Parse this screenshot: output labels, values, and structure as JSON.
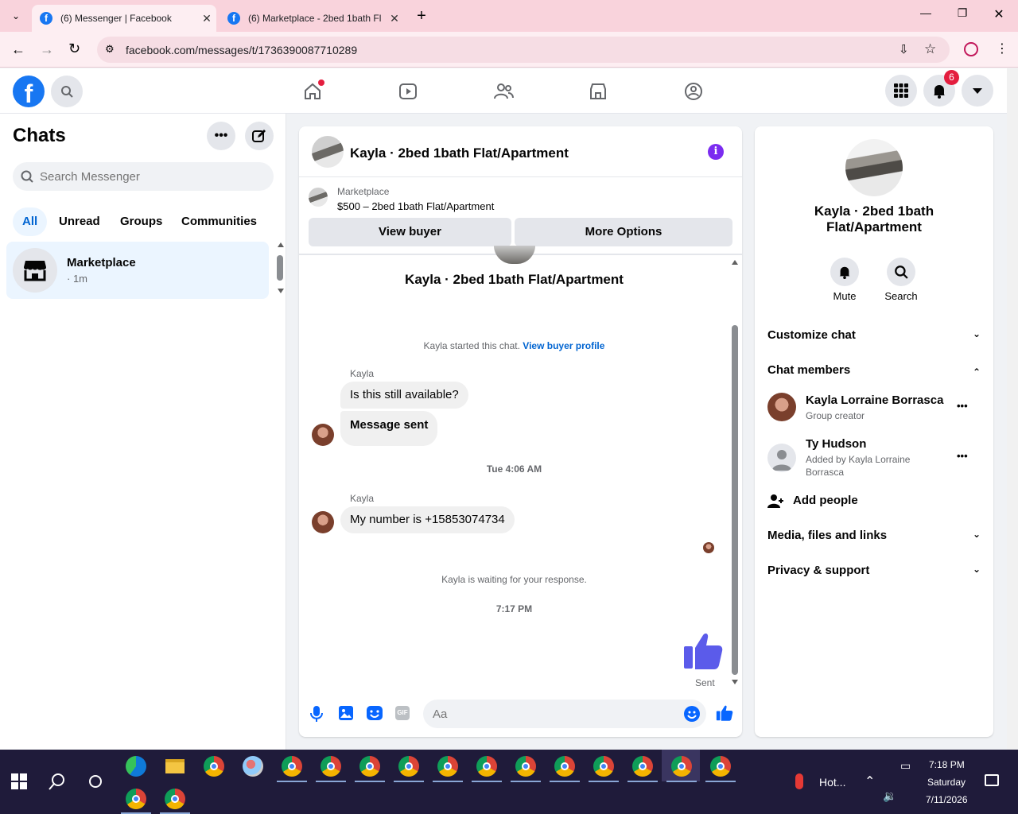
{
  "browser": {
    "tabs": [
      {
        "title": "(6) Messenger | Facebook",
        "active": true
      },
      {
        "title": "(6) Marketplace - 2bed 1bath Fl",
        "active": false
      }
    ],
    "url": "facebook.com/messages/t/1736390087710289"
  },
  "header": {
    "notification_count": "6"
  },
  "chats": {
    "title": "Chats",
    "search_placeholder": "Search Messenger",
    "filters": [
      "All",
      "Unread",
      "Groups",
      "Communities"
    ],
    "items": [
      {
        "name": "Marketplace",
        "time": "· 1m"
      }
    ]
  },
  "conversation": {
    "title": "Kayla · 2bed 1bath Flat/Apartment",
    "listing_label": "Marketplace",
    "listing_detail": "$500 – 2bed 1bath Flat/Apartment",
    "view_buyer": "View buyer",
    "more_options": "More Options",
    "intro_name": "Kayla · 2bed 1bath Flat/Apartment",
    "started_text": "Kayla started this chat.",
    "view_profile_link": "View buyer profile",
    "sender1": "Kayla",
    "msg1": "Is this still available?",
    "msg2": "Message sent",
    "timestamp1": "Tue 4:06 AM",
    "sender2": "Kayla",
    "msg3": "My number is +15853074734",
    "waiting_text": "Kayla is waiting for your response.",
    "timestamp2": "7:17 PM",
    "sent_status": "Sent",
    "composer_placeholder": "Aa"
  },
  "details": {
    "name_line1": "Kayla · 2bed 1bath",
    "name_line2": "Flat/Apartment",
    "mute": "Mute",
    "search": "Search",
    "customize": "Customize chat",
    "members_title": "Chat members",
    "member1_name": "Kayla Lorraine Borrasca",
    "member1_role": "Group creator",
    "member2_name": "Ty Hudson",
    "member2_role_line1": "Added by Kayla Lorraine",
    "member2_role_line2": "Borrasca",
    "add_people": "Add people",
    "media": "Media, files and links",
    "privacy": "Privacy & support"
  },
  "taskbar": {
    "weather": "Hot...",
    "time": "7:18 PM",
    "day": "Saturday",
    "date": "7/11/2026"
  },
  "colors": {
    "accent_purple": "#7b2cf0",
    "facebook_blue": "#1877f2",
    "like_blue": "#5b5bea"
  }
}
